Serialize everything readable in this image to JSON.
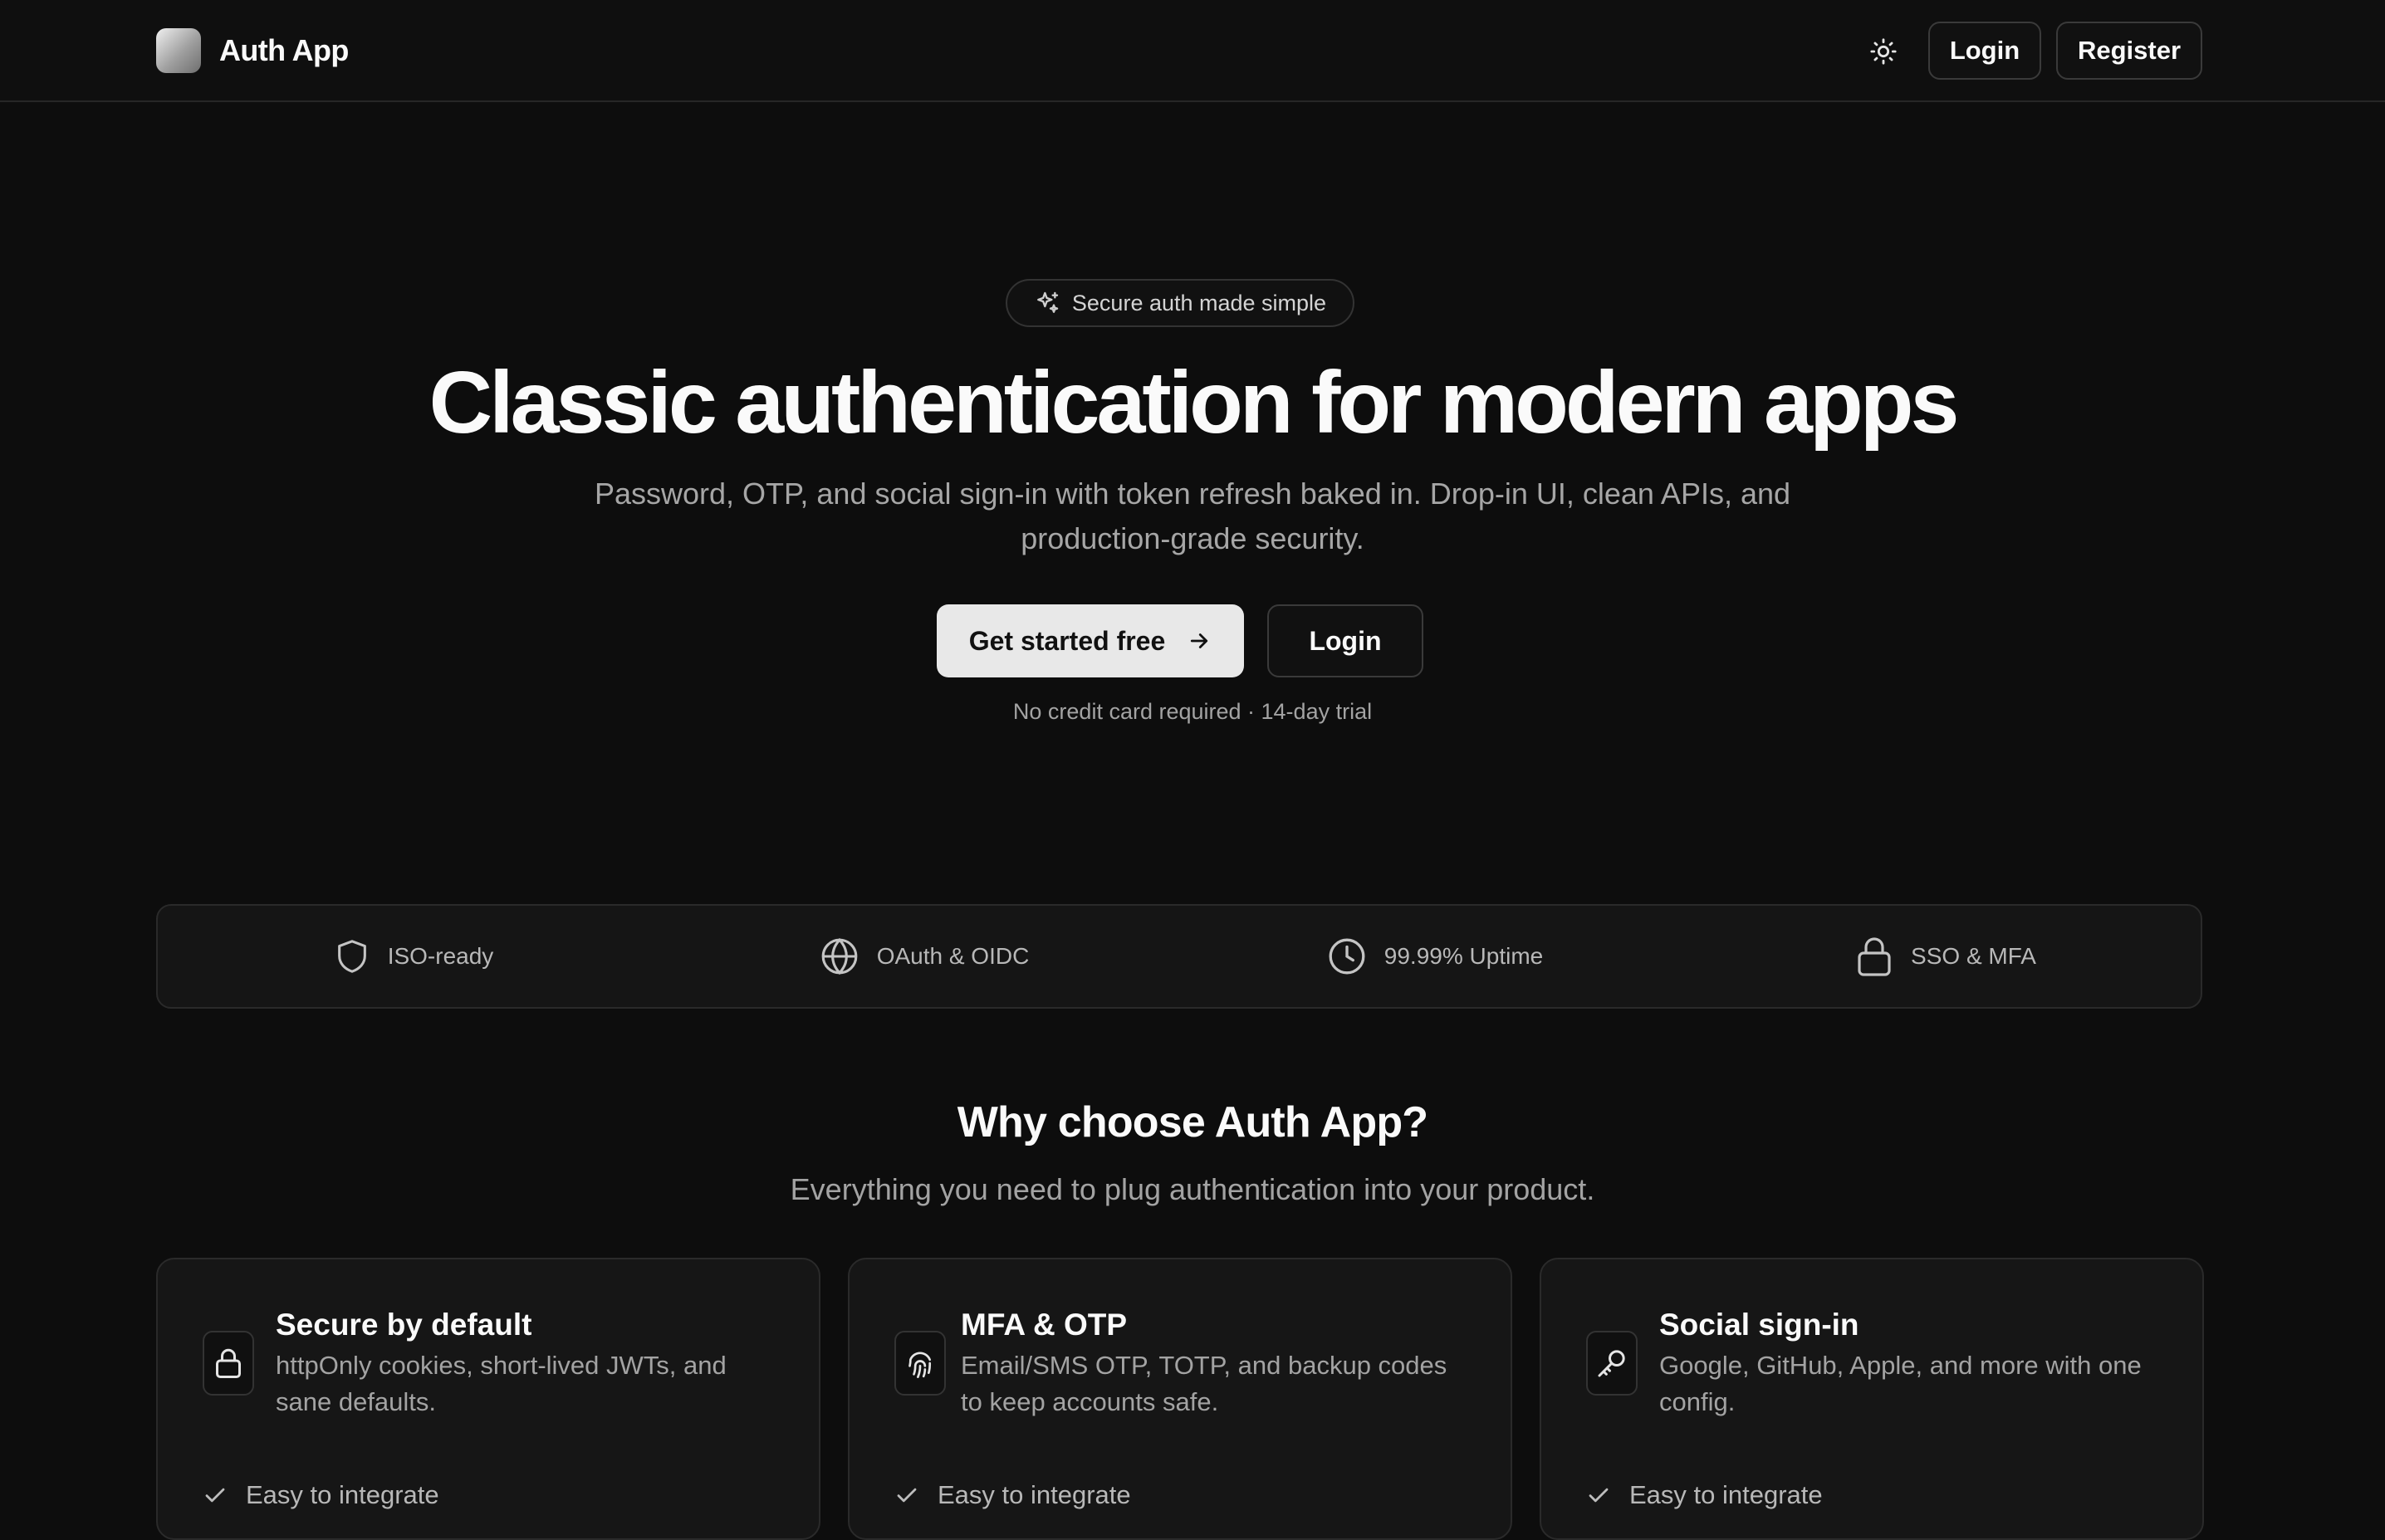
{
  "header": {
    "brand": "Auth App",
    "theme_toggle_icon": "sun-icon",
    "login_label": "Login",
    "register_label": "Register"
  },
  "hero": {
    "badge_icon": "sparkles-icon",
    "badge_text": "Secure auth made simple",
    "title": "Classic authentication for modern apps",
    "subtitle_line1": "Password, OTP, and social sign-in with token refresh baked in. Drop-in UI, clean APIs, and",
    "subtitle_line2": "production-grade security.",
    "cta_primary": "Get started free",
    "cta_primary_icon": "arrow-right-icon",
    "cta_secondary": "Login",
    "note": "No credit card required · 14-day trial"
  },
  "stats": [
    {
      "icon": "shield-icon",
      "label": "ISO-ready"
    },
    {
      "icon": "globe-icon",
      "label": "OAuth & OIDC"
    },
    {
      "icon": "clock-icon",
      "label": "99.99% Uptime"
    },
    {
      "icon": "lock-icon",
      "label": "SSO & MFA"
    }
  ],
  "features": {
    "title": "Why choose Auth App?",
    "subtitle": "Everything you need to plug authentication into your product.",
    "cards": [
      {
        "icon": "lock-icon",
        "title": "Secure by default",
        "desc": "httpOnly cookies, short-lived JWTs, and sane defaults.",
        "check": "Easy to integrate"
      },
      {
        "icon": "fingerprint-icon",
        "title": "MFA & OTP",
        "desc": "Email/SMS OTP, TOTP, and backup codes to keep accounts safe.",
        "check": "Easy to integrate"
      },
      {
        "icon": "key-icon",
        "title": "Social sign-in",
        "desc": "Google, GitHub, Apple, and more with one config.",
        "check": "Easy to integrate"
      }
    ]
  },
  "colors": {
    "background": "#0d0d0d",
    "text": "#fafafa",
    "muted": "#a3a3a3",
    "border": "#2a2a2a",
    "primary_button": "#e8e8e8"
  }
}
